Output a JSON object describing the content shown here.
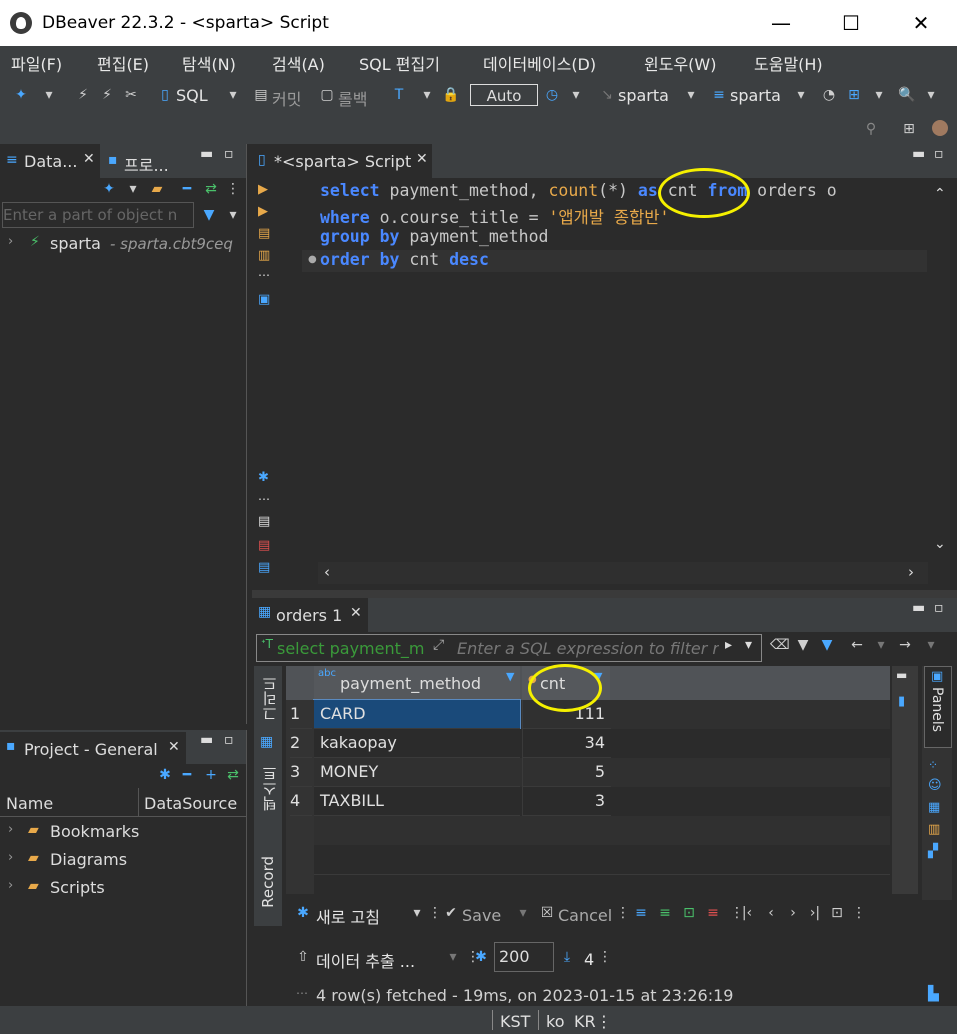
{
  "window": {
    "title": "DBeaver 22.3.2 - <sparta> Script",
    "minimize": "—",
    "maximize": "☐",
    "close": "✕"
  },
  "menu": [
    "파일(F)",
    "편집(E)",
    "탐색(N)",
    "검색(A)",
    "SQL 편집기",
    "데이터베이스(D)",
    "윈도우(W)",
    "도움말(H)"
  ],
  "toolbar": {
    "sql_label": "SQL",
    "commit_label": "커밋",
    "rollback_label": "롤백",
    "auto_label": "Auto",
    "datasource_label": "sparta",
    "schema_label": "sparta"
  },
  "db_navigator": {
    "tab_label": "Data...",
    "projects_tab_label": "프로...",
    "filter_placeholder": "Enter a part of object n",
    "tree": [
      {
        "name": "sparta",
        "detail": "- sparta.cbt9ceq"
      }
    ]
  },
  "project_panel": {
    "tab_label": "Project - General",
    "columns": [
      "Name",
      "DataSource"
    ],
    "items": [
      "Bookmarks",
      "Diagrams",
      "Scripts"
    ]
  },
  "editor": {
    "tab_label": "*<sparta> Script",
    "lines": [
      {
        "parts": [
          [
            "kw",
            "select "
          ],
          [
            "id",
            "payment_method, "
          ],
          [
            "fn",
            "count"
          ],
          [
            "id",
            "(*) "
          ],
          [
            "kw",
            "as "
          ],
          [
            "id",
            "cnt "
          ],
          [
            "kw",
            "from "
          ],
          [
            "id",
            "orders o"
          ]
        ]
      },
      {
        "parts": [
          [
            "kw",
            "where "
          ],
          [
            "id",
            "o.course_title = "
          ],
          [
            "str",
            "'앱개발 종합반'"
          ]
        ]
      },
      {
        "parts": [
          [
            "kw",
            "group by "
          ],
          [
            "id",
            "payment_method"
          ]
        ]
      },
      {
        "parts": [
          [
            "kw",
            "order by "
          ],
          [
            "id",
            "cnt "
          ],
          [
            "kw",
            "desc"
          ]
        ]
      }
    ]
  },
  "results": {
    "tab_label": "orders 1",
    "filter_query": "select payment_m",
    "filter_placeholder": "Enter a SQL expression to filter r",
    "columns": [
      "payment_method",
      "cnt"
    ],
    "rows": [
      {
        "n": "1",
        "payment_method": "CARD",
        "cnt": "111"
      },
      {
        "n": "2",
        "payment_method": "kakaopay",
        "cnt": "34"
      },
      {
        "n": "3",
        "payment_method": "MONEY",
        "cnt": "5"
      },
      {
        "n": "4",
        "payment_method": "TAXBILL",
        "cnt": "3"
      }
    ],
    "side_tabs": [
      "그리드",
      "텍스트",
      "Record"
    ],
    "panels_label": "Panels",
    "refresh_label": "새로 고침",
    "save_label": "Save",
    "cancel_label": "Cancel",
    "export_label": "데이터 추출 ...",
    "fetch_size": "200",
    "row_count": "4",
    "status": "4 row(s) fetched - 19ms, on 2023-01-15 at 23:26:19"
  },
  "statusbar": {
    "tz": "KST",
    "lang": "ko",
    "region": "KR"
  },
  "colors": {
    "annotation": "#f5f000",
    "keyword": "#4a88ff",
    "selected_row": "#1a4a7a"
  }
}
